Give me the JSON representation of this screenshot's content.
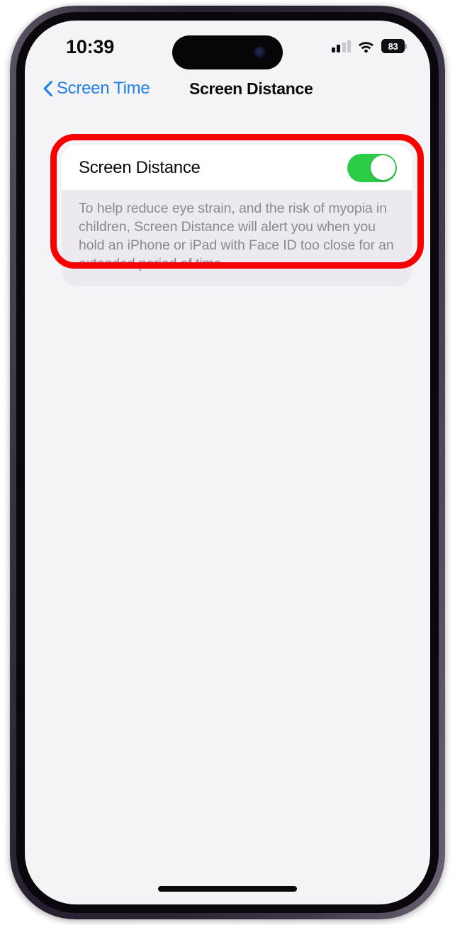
{
  "status_bar": {
    "time": "10:39",
    "signal_icon": "cellular-signal-icon",
    "signal_bars_total": 4,
    "signal_bars_filled": 2,
    "wifi_icon": "wifi-icon",
    "battery_icon": "battery-icon",
    "battery_percent": "83"
  },
  "nav": {
    "back_icon": "chevron-left-icon",
    "back_label": "Screen Time",
    "title": "Screen Distance"
  },
  "settings": {
    "row_label": "Screen Distance",
    "toggle_state": "on",
    "toggle_color": "#2dcc46",
    "description": "To help reduce eye strain, and the risk of myopia in children, Screen Distance will alert you when you hold an iPhone or iPad with Face ID too close for an extended period of time."
  },
  "annotation": {
    "highlight_color": "#f80000",
    "target": "screen-distance-setting-card"
  },
  "device": {
    "dynamic_island": "dynamic-island",
    "camera": "front-camera-dot",
    "home_indicator": "home-indicator",
    "buttons": {
      "silence": "silence-switch",
      "volume_up": "volume-up-button",
      "volume_down": "volume-down-button",
      "power": "power-button"
    }
  }
}
